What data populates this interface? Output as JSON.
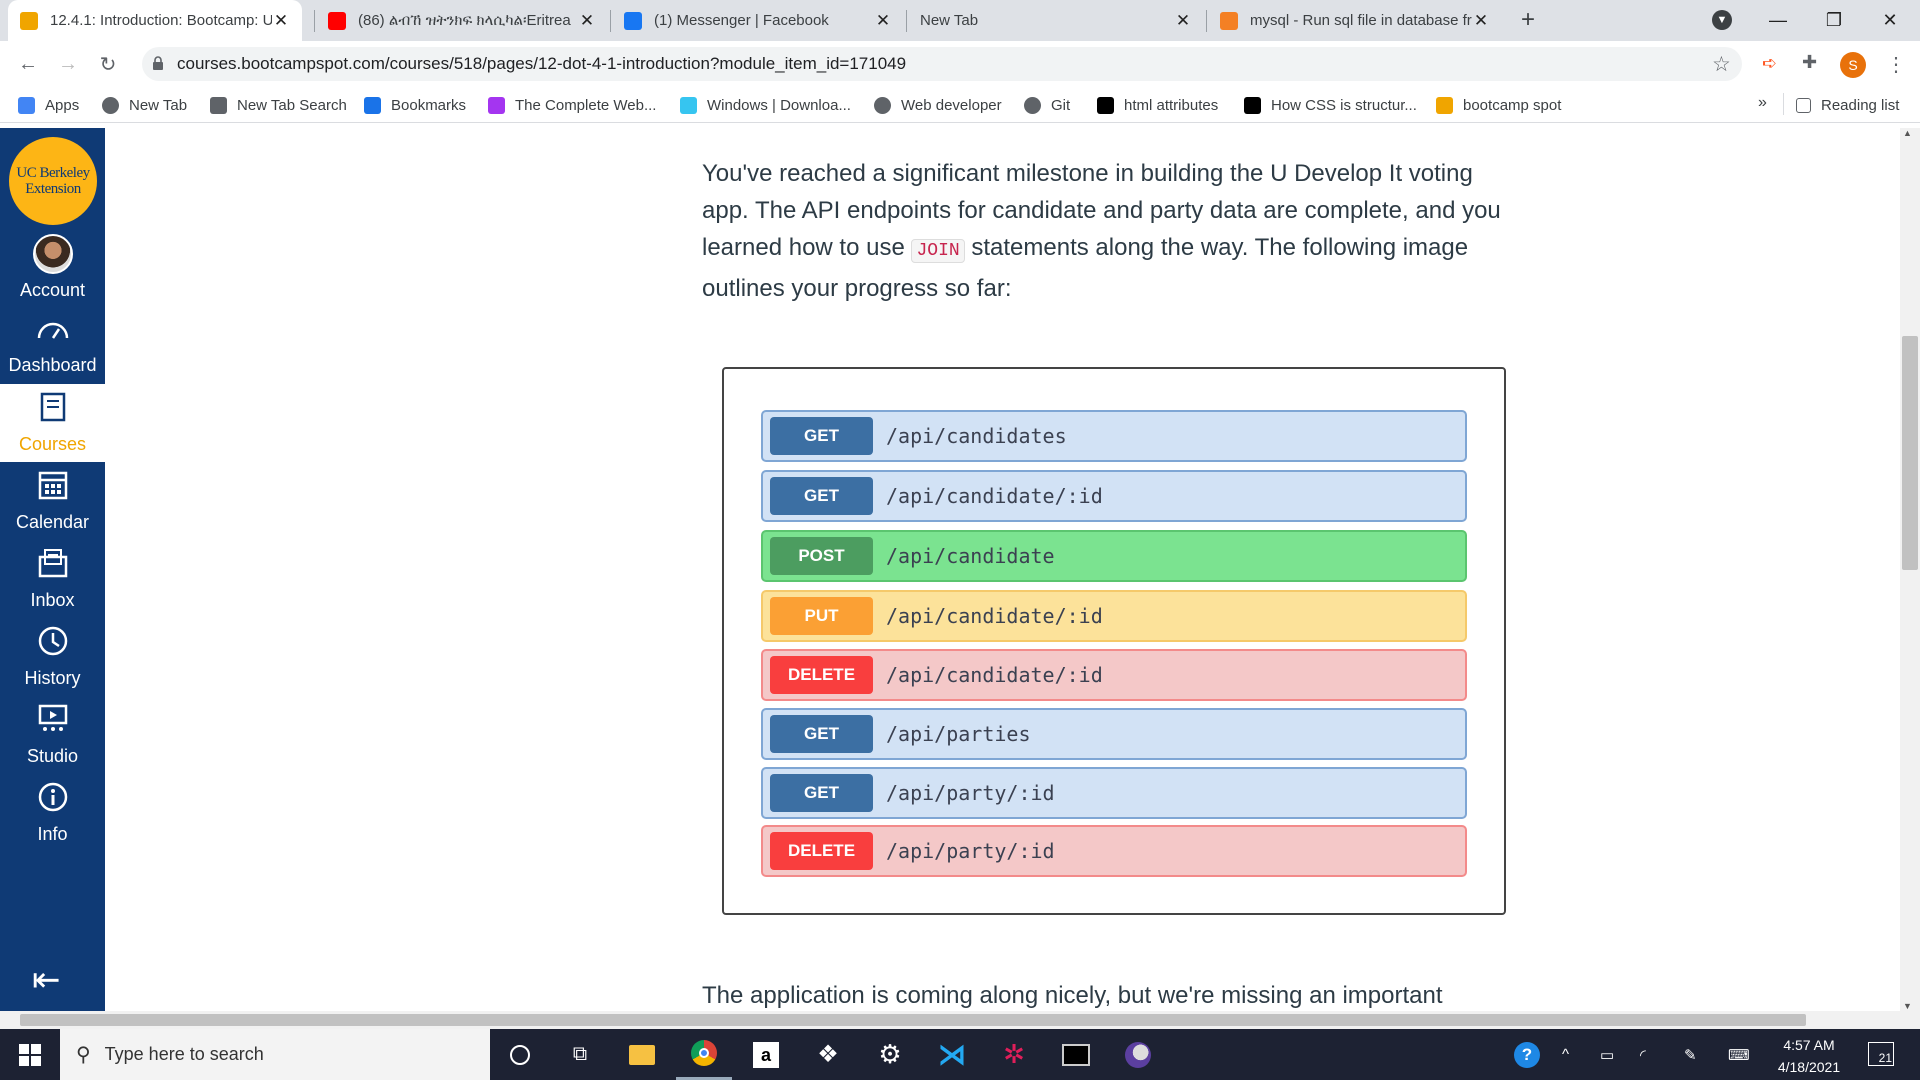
{
  "browser": {
    "tabs": [
      {
        "title": "12.4.1: Introduction: Bootcamp: U",
        "icon": "bootcamp-favicon",
        "color": "#f0a500",
        "active": true
      },
      {
        "title": "(86) ልብኸ ዝትንክፍ ክላሲካል፡Eritrea",
        "icon": "youtube-favicon",
        "color": "#ff0000",
        "active": false
      },
      {
        "title": "(1) Messenger | Facebook",
        "icon": "facebook-favicon",
        "color": "#1877f2",
        "active": false
      },
      {
        "title": "New Tab",
        "icon": "none",
        "color": "",
        "active": false
      },
      {
        "title": "mysql - Run sql file in database fr",
        "icon": "stackoverflow-favicon",
        "color": "#f48024",
        "active": false
      }
    ],
    "new_tab_glyph": "+",
    "url": "courses.bootcampspot.com/courses/518/pages/12-dot-4-1-introduction?module_item_id=171049",
    "profile_initial": "S",
    "bookmarks": [
      {
        "label": "Apps",
        "icon": "apps-grid-icon"
      },
      {
        "label": "New Tab",
        "icon": "globe-icon"
      },
      {
        "label": "New Tab Search",
        "icon": "search-icon"
      },
      {
        "label": "Bookmarks",
        "icon": "star-icon"
      },
      {
        "label": "The Complete Web...",
        "icon": "udemy-icon"
      },
      {
        "label": "Windows | Downloa...",
        "icon": "slack-icon"
      },
      {
        "label": "Web developer",
        "icon": "globe-icon"
      },
      {
        "label": "Git",
        "icon": "globe-icon"
      },
      {
        "label": "html attributes",
        "icon": "codepen-icon"
      },
      {
        "label": "How CSS is structur...",
        "icon": "codepen-icon"
      },
      {
        "label": "bootcamp spot",
        "icon": "bootcamp-favicon"
      }
    ],
    "bookmarks_overflow": "»",
    "reading_list": "Reading list"
  },
  "sidebar": {
    "logo_line1": "UC Berkeley",
    "logo_line2": "Extension",
    "items": [
      {
        "label": "Account",
        "icon": "avatar-icon",
        "active": false
      },
      {
        "label": "Dashboard",
        "icon": "dashboard-icon",
        "active": false
      },
      {
        "label": "Courses",
        "icon": "courses-icon",
        "active": true
      },
      {
        "label": "Calendar",
        "icon": "calendar-icon",
        "active": false
      },
      {
        "label": "Inbox",
        "icon": "inbox-icon",
        "active": false
      },
      {
        "label": "History",
        "icon": "history-icon",
        "active": false
      },
      {
        "label": "Studio",
        "icon": "studio-icon",
        "active": false
      },
      {
        "label": "Info",
        "icon": "info-icon",
        "active": false
      }
    ],
    "collapse_glyph": "⇤"
  },
  "content": {
    "para1_a": "You've reached a significant milestone in building the U Develop It voting app. The API endpoints for candidate and party data are complete, and you learned how to use ",
    "para1_code": "JOIN",
    "para1_b": " statements along the way. The following image outlines your progress so far:",
    "endpoints": [
      {
        "method": "GET",
        "path": "/api/candidates",
        "kind": "get"
      },
      {
        "method": "GET",
        "path": "/api/candidate/:id",
        "kind": "get"
      },
      {
        "method": "POST",
        "path": "/api/candidate",
        "kind": "post"
      },
      {
        "method": "PUT",
        "path": "/api/candidate/:id",
        "kind": "put"
      },
      {
        "method": "DELETE",
        "path": "/api/candidate/:id",
        "kind": "del"
      },
      {
        "method": "GET",
        "path": "/api/parties",
        "kind": "get"
      },
      {
        "method": "GET",
        "path": "/api/party/:id",
        "kind": "get"
      },
      {
        "method": "DELETE",
        "path": "/api/party/:id",
        "kind": "del"
      }
    ],
    "para2": "The application is coming along nicely, but we're missing an important"
  },
  "taskbar": {
    "search_placeholder": "Type here to search",
    "time": "4:57 AM",
    "date": "4/18/2021",
    "notification_count": "21"
  }
}
